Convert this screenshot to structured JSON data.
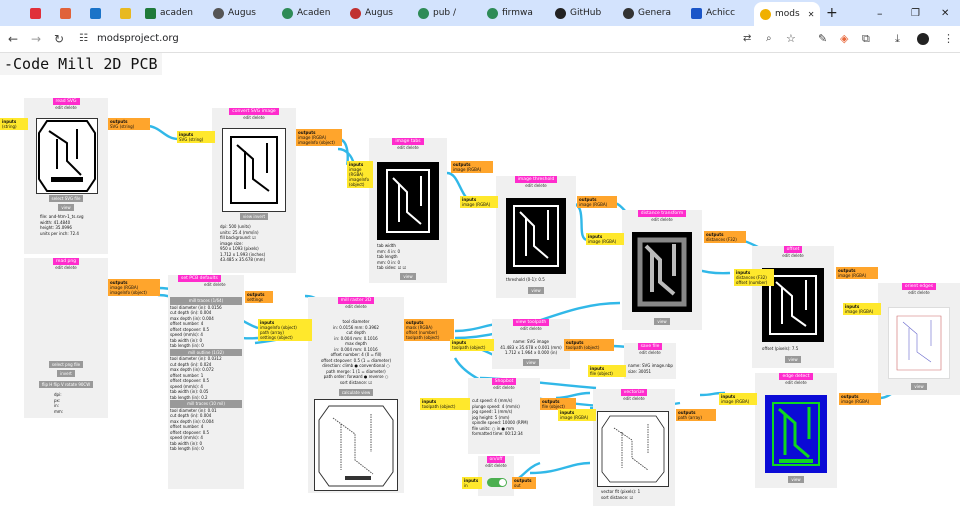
{
  "browser": {
    "tabs": [
      {
        "label": "",
        "icon": "youtube-icon",
        "color": "#e0303a"
      },
      {
        "label": "",
        "icon": "bank-icon",
        "color": "#e0623a"
      },
      {
        "label": "",
        "icon": "outlook-icon",
        "color": "#1a73c8"
      },
      {
        "label": "",
        "icon": "bookmark-icon",
        "color": "#e8b920"
      },
      {
        "label": "acaden",
        "icon": "academia-icon",
        "color": "#1f7a3a"
      },
      {
        "label": "Augus",
        "icon": "globe-icon",
        "color": "#555"
      },
      {
        "label": "Acaden",
        "icon": "fab-icon",
        "color": "#2e8b57"
      },
      {
        "label": "Augus",
        "icon": "github-icon",
        "color": "#c03030"
      },
      {
        "label": "pub / ",
        "icon": "fab-icon",
        "color": "#2e8b57"
      },
      {
        "label": "firmwa",
        "icon": "fab-icon",
        "color": "#2e8b57"
      },
      {
        "label": "GitHub",
        "icon": "github-icon",
        "color": "#222"
      },
      {
        "label": "Genera",
        "icon": "clock-icon",
        "color": "#333"
      },
      {
        "label": "Achicc",
        "icon": "achicc-icon",
        "color": "#1a55c8"
      },
      {
        "label": "mods",
        "icon": "sunglasses-icon",
        "color": "#f0b000",
        "active": true
      }
    ],
    "new_tab": "+",
    "url": "modsproject.org",
    "window_controls": {
      "min": "–",
      "max": "❐",
      "close": "✕"
    }
  },
  "page": {
    "title": "-Code Mill 2D PCB"
  },
  "mods": {
    "read_svg": {
      "name": "read SVG",
      "edit": "edit delete",
      "in_title": "inputs",
      "in_port": "(string)",
      "out_title": "outputs",
      "out_port": "SVG (string)",
      "btn1": "select SVG file",
      "btn2": "view",
      "lines": [
        "file: and-htm-1_ts.svg",
        "width: 41.4840",
        "height: 35.0996",
        "units per inch: 72.4"
      ]
    },
    "convert_svg": {
      "name": "convert SVG image",
      "edit": "edit delete",
      "in_title": "inputs",
      "in_port": "SVG (string)",
      "out_title": "outputs",
      "out_ports": [
        "image (RGBA)",
        "imageInfo (object)"
      ],
      "btn": "view  invert",
      "lines": [
        "dpi: 500   (units)",
        "units: 25.4   (mm/in)",
        "fill background: ☑",
        "image size:",
        "950 x 1093 (pixels)",
        "1.712 x 1.993 (inches)",
        "43.485 x 35.678 (mm)"
      ]
    },
    "image_tabs": {
      "name": "image tabs",
      "edit": "edit delete",
      "in_title": "inputs",
      "in_ports": [
        "image (RGBA)",
        "imageInfo (object)",
        "tab width",
        "tab length"
      ],
      "out_title": "outputs",
      "out_port": "image (RGBA)",
      "lines": [
        "tab width",
        "mm: 4   in: 0",
        "tab length",
        "mm: 0   in: 0",
        "tab sides: ☑ ☑"
      ],
      "btn": "view"
    },
    "image_threshold": {
      "name": "image threshold",
      "edit": "edit delete",
      "in_title": "inputs",
      "in_port": "image (RGBA)",
      "out_title": "outputs",
      "out_port": "image (RGBA)",
      "lines": [
        "threshold (0-1): 0.5"
      ],
      "btn": "view"
    },
    "distance_transform": {
      "name": "distance transform",
      "edit": "edit delete",
      "in_title": "inputs",
      "in_port": "image (RGBA)",
      "out_title": "outputs",
      "out_port": "distances (F32)",
      "btn": "view"
    },
    "offset": {
      "name": "offset",
      "edit": "edit delete",
      "in_title": "inputs",
      "in_ports": [
        "distances (F32)",
        "offset (number)"
      ],
      "out_title": "outputs",
      "out_port": "image (RGBA)",
      "lines": [
        "offset (pixels): 7.5"
      ],
      "btn": "view"
    },
    "orient_edges": {
      "name": "orient edges",
      "edit": "edit delete",
      "in_title": "inputs",
      "in_port": "image (RGBA)",
      "out_title": "outputs",
      "out_port": "vectors (array)",
      "btn": "view"
    },
    "edge_detect": {
      "name": "edge detect",
      "edit": "edit delete",
      "in_title": "inputs",
      "in_port": "image (RGBA)",
      "out_title": "outputs",
      "out_port": "image (RGBA)",
      "btn": "view"
    },
    "read_png": {
      "name": "read png",
      "edit": "edit delete",
      "out_title": "outputs",
      "out_ports": [
        "image (RGBA)",
        "imageInfo (object)"
      ],
      "btn1": "select png file",
      "btn2": "invert",
      "btn3": "flip H  flip V  rotate 90CW",
      "lines": [
        "dpi:",
        "px:",
        "in:",
        "mm:"
      ]
    },
    "set_pcb": {
      "name": "set PCB defaults",
      "edit": "edit delete",
      "sections": [
        {
          "header": "mill traces (1/64)",
          "rows": [
            "tool diameter (in): 0.0156",
            "cut depth (in): 0.004",
            "max depth (in): 0.004",
            "offset number: 4",
            "offset stepover: 0.5",
            "speed (mm/s): 4",
            "tab width (in): 0",
            "tab length (in): 0"
          ]
        },
        {
          "header": "mill outline (1/32)",
          "rows": [
            "tool diameter (in): 0.0312",
            "cut depth (in): 0.024",
            "max depth (in): 0.072",
            "offset number: 1",
            "offset stepover: 0.5",
            "speed (mm/s): 4",
            "tab width (in): 0.05",
            "tab length (in): 0.2"
          ]
        },
        {
          "header": "mill traces (10 mil)",
          "rows": [
            "tool diameter (in): 0.01",
            "cut depth (in): 0.004",
            "max depth (in): 0.004",
            "offset number: 4",
            "offset stepover: 0.5",
            "speed (mm/s): 4",
            "tab width (in): 0",
            "tab length (in): 0"
          ]
        }
      ],
      "out_title": "outputs",
      "out_port": "settings"
    },
    "mill_raster": {
      "name": "mill raster 2D",
      "edit": "edit delete",
      "in_title": "inputs",
      "in_ports": [
        "imageInfo (object)",
        "path (array)",
        "settings (object)"
      ],
      "out_title": "outputs",
      "out_ports": [
        "mask (RGBA)",
        "offset (number)",
        "toolpath (object)"
      ],
      "lines": [
        "tool diameter",
        "in: 0.0156   mm: 0.3962",
        "cut depth",
        "in: 0.004   mm: 0.1016",
        "max depth",
        "in: 0.004   mm: 0.1016",
        "offset number: 4   (0 = fill)",
        "offset stepover: 0.5   (1 = diameter)",
        "direction: climb ● conventional ○",
        "path merge: 1   (1 = diameter)",
        "path order: forward ● reverse ○",
        "sort distance: ☑"
      ],
      "btn": "calculate  view"
    },
    "view_toolpath": {
      "name": "view toolpath",
      "edit": "edit delete",
      "in_title": "inputs",
      "in_port": "toolpath (object)",
      "out_title": "outputs",
      "out_port": "toolpath (object)",
      "lines": [
        "name: SVG image",
        "41.483 x 35.678 x 0.001 (mm)",
        "1.712 x 1.964 x 0.000 (in)"
      ],
      "btn": "view"
    },
    "save_file": {
      "name": "save file",
      "edit": "edit delete",
      "in_title": "inputs",
      "in_port": "file (object)",
      "lines": [
        "name: SVG image.nbp",
        "size: 30051"
      ]
    },
    "roland": {
      "name": "Shopbot",
      "edit": "edit delete",
      "in_title": "inputs",
      "in_port": "toolpath (object)",
      "out_title": "outputs",
      "out_port": "file (object)",
      "lines": [
        "cut speed: 4   (mm/s)",
        "plunge speed: 4   (mm/s)",
        "jog speed: 1   (mm/s)",
        "jog height: 5   (mm)",
        "spindle speed: 10000   (RPM)",
        "file units: ○ in ● mm",
        "formatted time: 00:12:34"
      ]
    },
    "on_off": {
      "name": "on/off",
      "edit": "edit delete",
      "in_title": "inputs",
      "in_port": "in",
      "out_title": "outputs",
      "out_port": "out"
    },
    "vectorize": {
      "name": "vectorize",
      "edit": "edit delete",
      "in_title": "inputs",
      "in_port": "image (RGBA)",
      "out_title": "outputs",
      "out_port": "path (array)",
      "lines": [
        "vector fit (pixels): 1",
        "sort distance: ☑"
      ],
      "btn": "view"
    }
  },
  "colors": {
    "module_name": "#ff2ccd",
    "input": "#ffe82c",
    "output": "#ffa52c",
    "wire": "#31b8e8",
    "module_bg": "#f0f0f0",
    "edge_green": "#0fd81f",
    "edge_blue": "#0b0bd6"
  }
}
